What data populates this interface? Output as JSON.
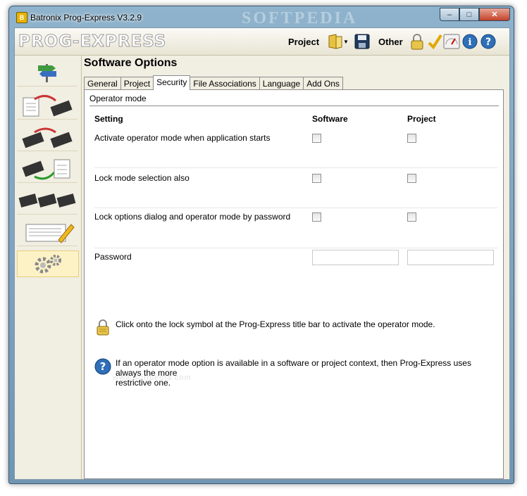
{
  "window": {
    "title": "Batronix Prog-Express V3.2.9",
    "watermark": "SOFTPEDIA"
  },
  "toolbar": {
    "logo": "PROG-EXPRESS",
    "project_label": "Project",
    "other_label": "Other"
  },
  "main": {
    "section_title": "Software Options",
    "tabs": [
      {
        "label": "General"
      },
      {
        "label": "Project"
      },
      {
        "label": "Security"
      },
      {
        "label": "File Associations"
      },
      {
        "label": "Language"
      },
      {
        "label": "Add Ons"
      }
    ],
    "active_tab": "Security",
    "group_title": "Operator mode",
    "columns": {
      "setting": "Setting",
      "software": "Software",
      "project": "Project"
    },
    "rows": [
      {
        "label": "Activate operator mode when application starts",
        "software": false,
        "project": false
      },
      {
        "label": "Lock mode selection also",
        "software": false,
        "project": false
      },
      {
        "label": "Lock options dialog and operator mode by password",
        "software": false,
        "project": false
      }
    ],
    "password": {
      "label": "Password",
      "software_value": "",
      "project_value": ""
    },
    "info_lock": "Click onto the lock symbol at the Prog-Express title bar to activate the operator mode.",
    "info_help_line1": "If an operator mode option is available in a software or project context, then Prog-Express uses always the more",
    "info_help_line2": "restrictive one.",
    "watermark": "www.softpedia.com"
  }
}
